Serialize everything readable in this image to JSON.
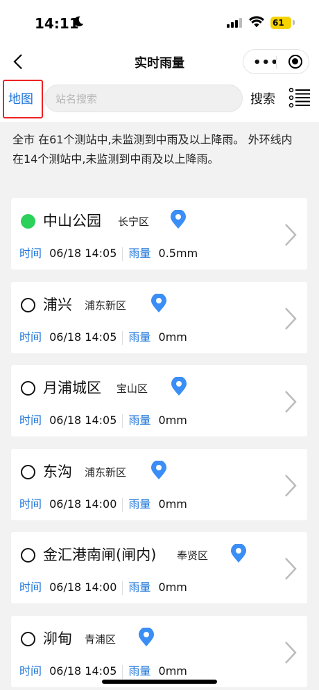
{
  "status": {
    "time": "14:11",
    "battery": "61"
  },
  "nav": {
    "title": "实时雨量"
  },
  "toolbar": {
    "map_label": "地图",
    "search_placeholder": "站名搜索",
    "search_label": "搜索"
  },
  "summary": "全市 在61个测站中,未监测到中雨及以上降雨。 外环线内 在14个测站中,未监测到中雨及以上降雨。",
  "labels": {
    "time": "时间",
    "rain": "雨量"
  },
  "stations": [
    {
      "name": "中山公园",
      "district": "长宁区",
      "time": "06/18 14:05",
      "rain": "0.5mm",
      "status": "green"
    },
    {
      "name": "浦兴",
      "district": "浦东新区",
      "time": "06/18 14:05",
      "rain": "0mm",
      "status": "empty"
    },
    {
      "name": "月浦城区",
      "district": "宝山区",
      "time": "06/18 14:05",
      "rain": "0mm",
      "status": "empty"
    },
    {
      "name": "东沟",
      "district": "浦东新区",
      "time": "06/18 14:00",
      "rain": "0mm",
      "status": "empty"
    },
    {
      "name": "金汇港南闸(闸内)",
      "district": "奉贤区",
      "time": "06/18 14:00",
      "rain": "0mm",
      "status": "empty"
    },
    {
      "name": "泖甸",
      "district": "青浦区",
      "time": "06/18 14:05",
      "rain": "0mm",
      "status": "empty"
    }
  ],
  "colors": {
    "accent": "#1a73d9",
    "active_dot": "#2bd15a",
    "highlight_border": "#ee2222"
  }
}
